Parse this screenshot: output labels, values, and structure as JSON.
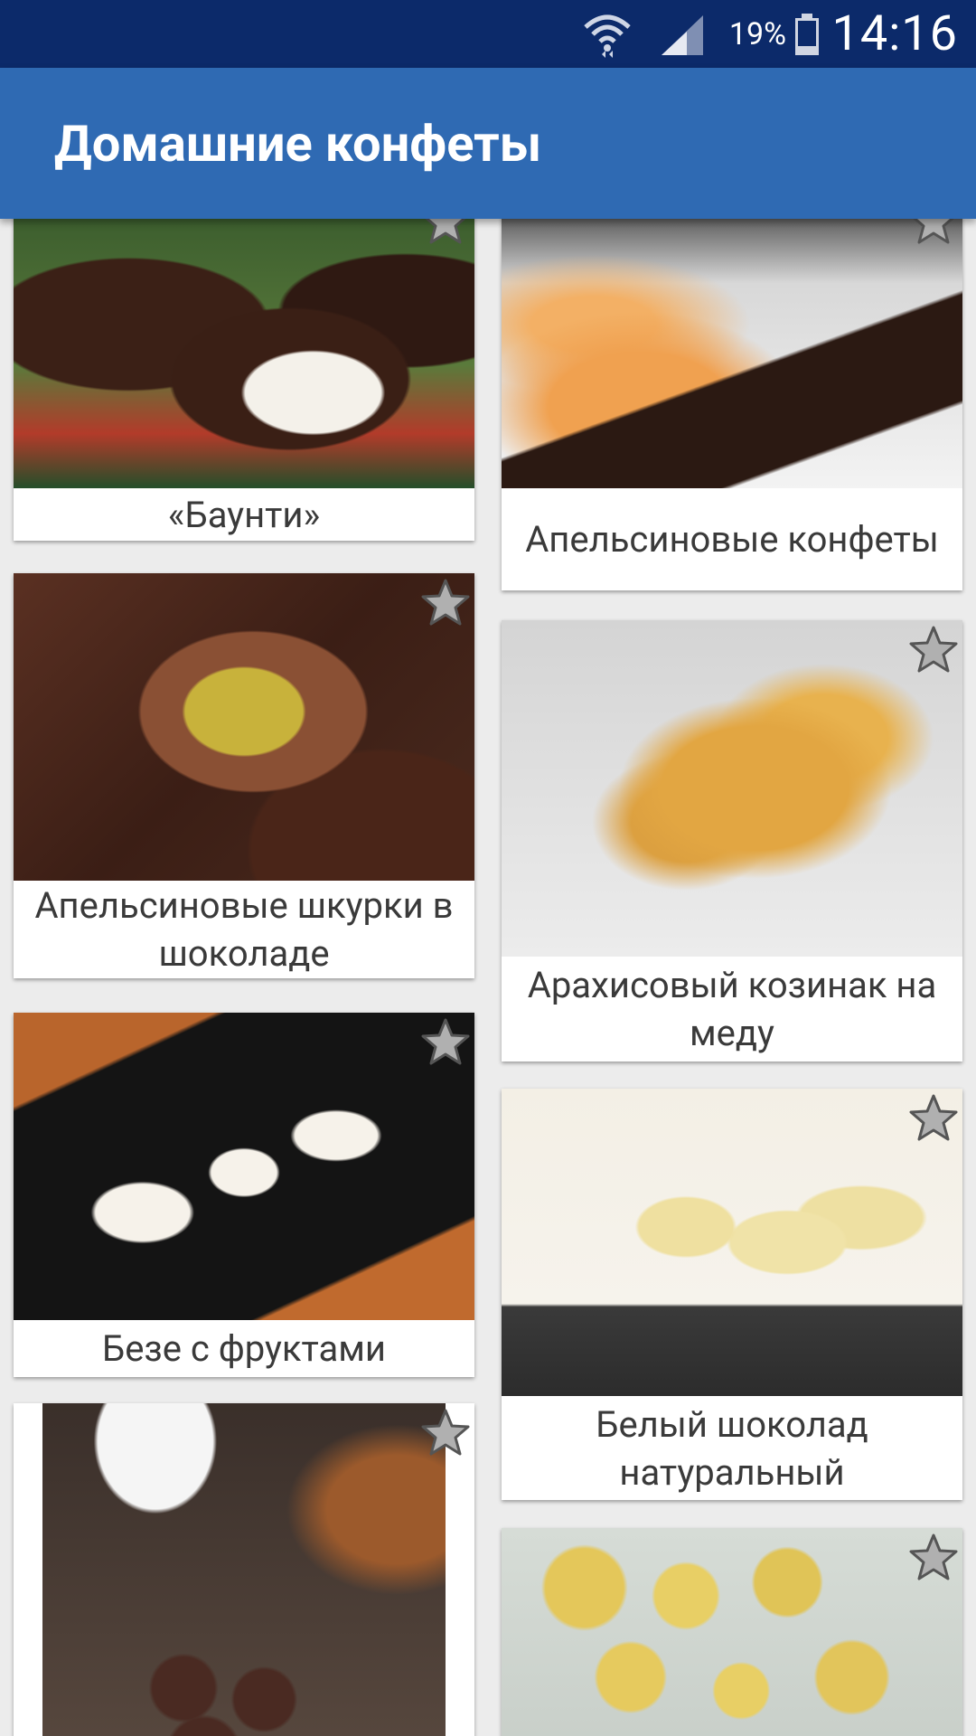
{
  "status_bar": {
    "time": "14:16",
    "battery_percent": "19%",
    "icons": [
      "wifi-icon",
      "signal-icon",
      "battery-icon"
    ]
  },
  "app_bar": {
    "title": "Домашние конфеты",
    "background": "#2f6ab3"
  },
  "recipes": [
    {
      "title": "«Баунти»",
      "photo": "bounty-photo",
      "favorite": false
    },
    {
      "title": "Апельсиновые конфеты",
      "photo": "orange-candies-photo",
      "favorite": false
    },
    {
      "title": "Апельсиновые шкурки в шоколаде",
      "photo": "orange-peel-chocolate-photo",
      "favorite": false
    },
    {
      "title": "Арахисовый козинак на меду",
      "photo": "peanut-kozinak-photo",
      "favorite": false
    },
    {
      "title": "Безе с фруктами",
      "photo": "meringue-fruits-photo",
      "favorite": false
    },
    {
      "title": "Белый шоколад натуральный",
      "photo": "white-chocolate-photo",
      "favorite": false
    },
    {
      "title": "",
      "photo": "truffles-photo",
      "favorite": false
    },
    {
      "title": "",
      "photo": "yellow-balls-photo",
      "favorite": false
    }
  ]
}
